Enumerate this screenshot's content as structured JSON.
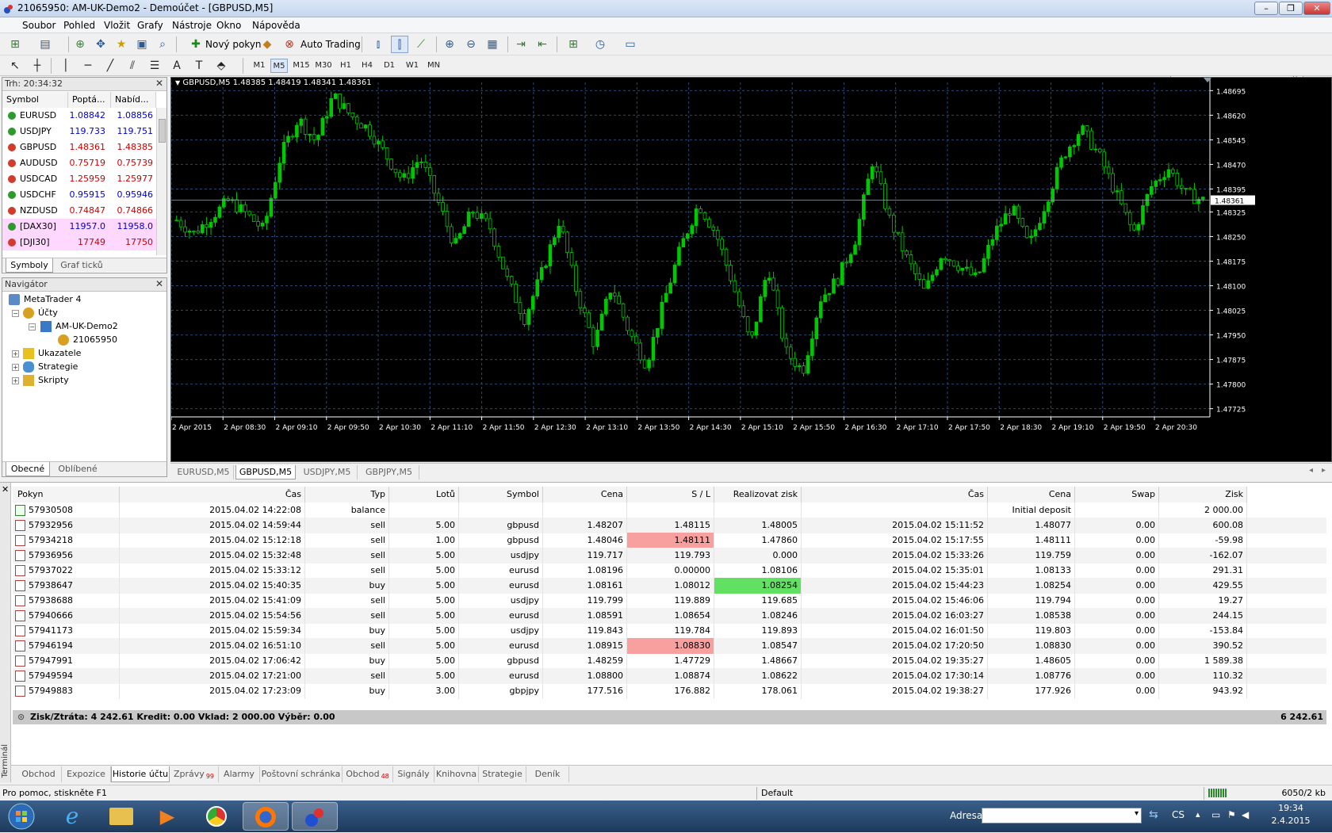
{
  "window": {
    "title": "21065950: AM-UK-Demo2 - Demoúčet - [GBPUSD,M5]"
  },
  "menu": [
    "Soubor",
    "Pohled",
    "Vložit",
    "Grafy",
    "Nástroje",
    "Okno",
    "Nápověda"
  ],
  "toolbar": {
    "new_order": "Nový pokyn",
    "auto_trading": "Auto Trading"
  },
  "timeframes": [
    "M1",
    "M5",
    "M15",
    "M30",
    "H1",
    "H4",
    "D1",
    "W1",
    "MN"
  ],
  "active_timeframe": "M5",
  "market_watch": {
    "title": "Trh: 20:34:32",
    "headers": {
      "symbol": "Symbol",
      "bid": "Poptá...",
      "ask": "Nabíd..."
    },
    "rows": [
      {
        "symbol": "EURUSD",
        "bid": "1.08842",
        "ask": "1.08856",
        "dir": "up",
        "color": "#0000cc",
        "bg": "#ffffff"
      },
      {
        "symbol": "USDJPY",
        "bid": "119.733",
        "ask": "119.751",
        "dir": "up",
        "color": "#0000cc",
        "bg": "#ffffff"
      },
      {
        "symbol": "GBPUSD",
        "bid": "1.48361",
        "ask": "1.48385",
        "dir": "dn",
        "color": "#cc0000",
        "bg": "#ffffff"
      },
      {
        "symbol": "AUDUSD",
        "bid": "0.75719",
        "ask": "0.75739",
        "dir": "dn",
        "color": "#cc0000",
        "bg": "#ffffff"
      },
      {
        "symbol": "USDCAD",
        "bid": "1.25959",
        "ask": "1.25977",
        "dir": "dn",
        "color": "#cc0000",
        "bg": "#ffffff"
      },
      {
        "symbol": "USDCHF",
        "bid": "0.95915",
        "ask": "0.95946",
        "dir": "up",
        "color": "#0000cc",
        "bg": "#ffffff"
      },
      {
        "symbol": "NZDUSD",
        "bid": "0.74847",
        "ask": "0.74866",
        "dir": "dn",
        "color": "#cc0000",
        "bg": "#ffffff"
      },
      {
        "symbol": "[DAX30]",
        "bid": "11957.0",
        "ask": "11958.0",
        "dir": "up",
        "color": "#0000cc",
        "bg": "#ffd8ff"
      },
      {
        "symbol": "[DJI30]",
        "bid": "17749",
        "ask": "17750",
        "dir": "dn",
        "color": "#cc0000",
        "bg": "#ffd8ff"
      }
    ],
    "tabs": [
      "Symboly",
      "Graf ticků"
    ]
  },
  "navigator": {
    "title": "Navigátor",
    "items": [
      "MetaTrader 4",
      "Účty",
      "AM-UK-Demo2",
      "21065950",
      "Ukazatele",
      "Strategie",
      "Skripty"
    ],
    "tabs": [
      "Obecné",
      "Oblíbené"
    ]
  },
  "chart": {
    "info": "GBPUSD,M5  1.48385 1.48419 1.48341 1.48361",
    "current_price_label": "1.48361",
    "colors": {
      "bull": "#00c800",
      "bear": "#000000",
      "axis": "#ffffff",
      "grid": "#2c4a6e"
    }
  },
  "chart_data": {
    "type": "candlestick",
    "y_ticks": [
      "1.48695",
      "1.48620",
      "1.48545",
      "1.48470",
      "1.48395",
      "1.48325",
      "1.48250",
      "1.48175",
      "1.48100",
      "1.48025",
      "1.47950",
      "1.47875",
      "1.47800",
      "1.47725"
    ],
    "x_ticks": [
      "2 Apr 2015",
      "2 Apr 08:30",
      "2 Apr 09:10",
      "2 Apr 09:50",
      "2 Apr 10:30",
      "2 Apr 11:10",
      "2 Apr 11:50",
      "2 Apr 12:30",
      "2 Apr 13:10",
      "2 Apr 13:50",
      "2 Apr 14:30",
      "2 Apr 15:10",
      "2 Apr 15:50",
      "2 Apr 16:30",
      "2 Apr 17:10",
      "2 Apr 17:50",
      "2 Apr 18:30",
      "2 Apr 19:10",
      "2 Apr 19:50",
      "2 Apr 20:30"
    ],
    "ylim": [
      1.477,
      1.4872
    ],
    "current_price": 1.48361,
    "close_path": [
      1.483,
      1.4826,
      1.4831,
      1.4836,
      1.4832,
      1.4827,
      1.485,
      1.4861,
      1.4854,
      1.4868,
      1.4862,
      1.4858,
      1.485,
      1.4842,
      1.4849,
      1.4836,
      1.4822,
      1.4833,
      1.4828,
      1.4812,
      1.48,
      1.4814,
      1.483,
      1.4808,
      1.4792,
      1.481,
      1.4796,
      1.4786,
      1.4805,
      1.4822,
      1.4835,
      1.4826,
      1.481,
      1.4792,
      1.4816,
      1.479,
      1.4784,
      1.4806,
      1.4812,
      1.4824,
      1.4848,
      1.483,
      1.4818,
      1.4808,
      1.482,
      1.4816,
      1.4812,
      1.4826,
      1.4834,
      1.4822,
      1.4836,
      1.485,
      1.4858,
      1.485,
      1.4838,
      1.4826,
      1.484,
      1.4846,
      1.4838,
      1.4836
    ],
    "open_path_offset_note": ""
  },
  "chart_tabs": [
    "EURUSD,M5",
    "GBPUSD,M5",
    "USDJPY,M5",
    "GBPJPY,M5"
  ],
  "terminal": {
    "side_label": "Terminál",
    "headers": [
      "Pokyn",
      "Čas",
      "Typ",
      "Lotů",
      "Symbol",
      "Cena",
      "S / L",
      "Realizovat zisk",
      "Čas",
      "Cena",
      "Swap",
      "Zisk"
    ],
    "rows": [
      {
        "order": "57930508",
        "time": "2015.04.02 14:22:08",
        "type": "balance",
        "lots": "",
        "symbol": "",
        "price": "",
        "sl": "",
        "tp": "",
        "ctime": "",
        "cprice": "Initial deposit",
        "swap": "",
        "profit": "2 000.00",
        "kind": "balance",
        "sl_hl": "",
        "tp_hl": ""
      },
      {
        "order": "57932956",
        "time": "2015.04.02 14:59:44",
        "type": "sell",
        "lots": "5.00",
        "symbol": "gbpusd",
        "price": "1.48207",
        "sl": "1.48115",
        "tp": "1.48005",
        "ctime": "2015.04.02 15:11:52",
        "cprice": "1.48077",
        "swap": "0.00",
        "profit": "600.08",
        "kind": "order",
        "sl_hl": "",
        "tp_hl": ""
      },
      {
        "order": "57934218",
        "time": "2015.04.02 15:12:18",
        "type": "sell",
        "lots": "1.00",
        "symbol": "gbpusd",
        "price": "1.48046",
        "sl": "1.48111",
        "tp": "1.47860",
        "ctime": "2015.04.02 15:17:55",
        "cprice": "1.48111",
        "swap": "0.00",
        "profit": "-59.98",
        "kind": "order",
        "sl_hl": "red",
        "tp_hl": ""
      },
      {
        "order": "57936956",
        "time": "2015.04.02 15:32:48",
        "type": "sell",
        "lots": "5.00",
        "symbol": "usdjpy",
        "price": "119.717",
        "sl": "119.793",
        "tp": "0.000",
        "ctime": "2015.04.02 15:33:26",
        "cprice": "119.759",
        "swap": "0.00",
        "profit": "-162.07",
        "kind": "order",
        "sl_hl": "",
        "tp_hl": ""
      },
      {
        "order": "57937022",
        "time": "2015.04.02 15:33:12",
        "type": "sell",
        "lots": "5.00",
        "symbol": "eurusd",
        "price": "1.08196",
        "sl": "0.00000",
        "tp": "1.08106",
        "ctime": "2015.04.02 15:35:01",
        "cprice": "1.08133",
        "swap": "0.00",
        "profit": "291.31",
        "kind": "order",
        "sl_hl": "",
        "tp_hl": ""
      },
      {
        "order": "57938647",
        "time": "2015.04.02 15:40:35",
        "type": "buy",
        "lots": "5.00",
        "symbol": "eurusd",
        "price": "1.08161",
        "sl": "1.08012",
        "tp": "1.08254",
        "ctime": "2015.04.02 15:44:23",
        "cprice": "1.08254",
        "swap": "0.00",
        "profit": "429.55",
        "kind": "order",
        "sl_hl": "",
        "tp_hl": "green"
      },
      {
        "order": "57938688",
        "time": "2015.04.02 15:41:09",
        "type": "sell",
        "lots": "5.00",
        "symbol": "usdjpy",
        "price": "119.799",
        "sl": "119.889",
        "tp": "119.685",
        "ctime": "2015.04.02 15:46:06",
        "cprice": "119.794",
        "swap": "0.00",
        "profit": "19.27",
        "kind": "order",
        "sl_hl": "",
        "tp_hl": ""
      },
      {
        "order": "57940666",
        "time": "2015.04.02 15:54:56",
        "type": "sell",
        "lots": "5.00",
        "symbol": "eurusd",
        "price": "1.08591",
        "sl": "1.08654",
        "tp": "1.08246",
        "ctime": "2015.04.02 16:03:27",
        "cprice": "1.08538",
        "swap": "0.00",
        "profit": "244.15",
        "kind": "order",
        "sl_hl": "",
        "tp_hl": ""
      },
      {
        "order": "57941173",
        "time": "2015.04.02 15:59:34",
        "type": "buy",
        "lots": "5.00",
        "symbol": "usdjpy",
        "price": "119.843",
        "sl": "119.784",
        "tp": "119.893",
        "ctime": "2015.04.02 16:01:50",
        "cprice": "119.803",
        "swap": "0.00",
        "profit": "-153.84",
        "kind": "order",
        "sl_hl": "",
        "tp_hl": ""
      },
      {
        "order": "57946194",
        "time": "2015.04.02 16:51:10",
        "type": "sell",
        "lots": "5.00",
        "symbol": "eurusd",
        "price": "1.08915",
        "sl": "1.08830",
        "tp": "1.08547",
        "ctime": "2015.04.02 17:20:50",
        "cprice": "1.08830",
        "swap": "0.00",
        "profit": "390.52",
        "kind": "order",
        "sl_hl": "red",
        "tp_hl": ""
      },
      {
        "order": "57947991",
        "time": "2015.04.02 17:06:42",
        "type": "buy",
        "lots": "5.00",
        "symbol": "gbpusd",
        "price": "1.48259",
        "sl": "1.47729",
        "tp": "1.48667",
        "ctime": "2015.04.02 19:35:27",
        "cprice": "1.48605",
        "swap": "0.00",
        "profit": "1 589.38",
        "kind": "order",
        "sl_hl": "",
        "tp_hl": ""
      },
      {
        "order": "57949594",
        "time": "2015.04.02 17:21:00",
        "type": "sell",
        "lots": "5.00",
        "symbol": "eurusd",
        "price": "1.08800",
        "sl": "1.08874",
        "tp": "1.08622",
        "ctime": "2015.04.02 17:30:14",
        "cprice": "1.08776",
        "swap": "0.00",
        "profit": "110.32",
        "kind": "order",
        "sl_hl": "",
        "tp_hl": ""
      },
      {
        "order": "57949883",
        "time": "2015.04.02 17:23:09",
        "type": "buy",
        "lots": "3.00",
        "symbol": "gbpjpy",
        "price": "177.516",
        "sl": "176.882",
        "tp": "178.061",
        "ctime": "2015.04.02 19:38:27",
        "cprice": "177.926",
        "swap": "0.00",
        "profit": "943.92",
        "kind": "order",
        "sl_hl": "",
        "tp_hl": ""
      }
    ],
    "summary": "Zisk/Ztráta: 4 242.61  Kredit: 0.00  Vklad: 2 000.00  Výběr: 0.00",
    "summary_total": "6 242.61",
    "tabs": [
      {
        "label": "Obchod",
        "badge": ""
      },
      {
        "label": "Expozice",
        "badge": ""
      },
      {
        "label": "Historie účtu",
        "badge": ""
      },
      {
        "label": "Zprávy",
        "badge": "99"
      },
      {
        "label": "Alarmy",
        "badge": ""
      },
      {
        "label": "Poštovní schránka",
        "badge": ""
      },
      {
        "label": "Obchod",
        "badge": "48"
      },
      {
        "label": "Signály",
        "badge": ""
      },
      {
        "label": "Knihovna",
        "badge": ""
      },
      {
        "label": "Strategie",
        "badge": ""
      },
      {
        "label": "Deník",
        "badge": ""
      }
    ]
  },
  "status": {
    "help": "Pro pomoc, stiskněte F1",
    "profile": "Default",
    "traffic": "6050/2 kb"
  },
  "taskbar": {
    "address_label": "Adresa",
    "lang": "CS",
    "time": "19:34",
    "date": "2.4.2015"
  }
}
